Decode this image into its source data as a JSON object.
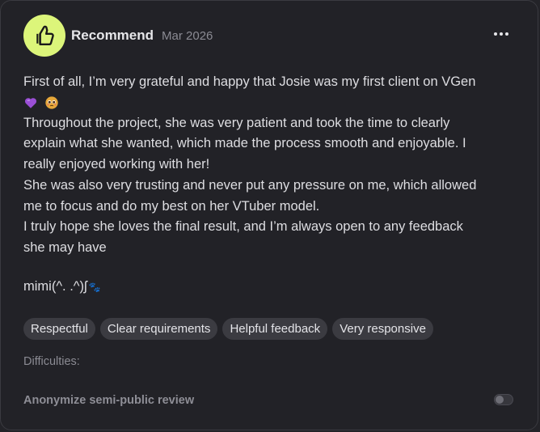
{
  "review": {
    "title": "Recommend",
    "date": "Mar 2026",
    "menu_icon": "more-horizontal-icon",
    "avatar_icon": "thumbs-up-icon",
    "avatar_color": "#dcf57a",
    "body_lines": [
      "First of all, I’m very grateful and happy that Josie was my first client on VGen",
      "Throughout the project, she was very patient and took the time to clearly",
      "explain what she wanted, which made the process smooth and enjoyable. I",
      "really enjoyed working with her!",
      "She was also very trusting and never put any pressure on me, which allowed",
      "me to focus and do my best on her VTuber model.",
      "I truly hope she loves the final result, and I’m always open to any feedback",
      "she may have"
    ],
    "emojis": [
      "purple-heart-emoji",
      "pleading-face-emoji"
    ],
    "signature": "mimi(^. .^)ʃ",
    "signature_icon": "paw-prints-icon",
    "tags": [
      "Respectful",
      "Clear requirements",
      "Helpful feedback",
      "Very responsive"
    ],
    "difficulties_label": "Difficulties:",
    "anonymize_label": "Anonymize semi-public review",
    "anonymize_enabled": false
  }
}
